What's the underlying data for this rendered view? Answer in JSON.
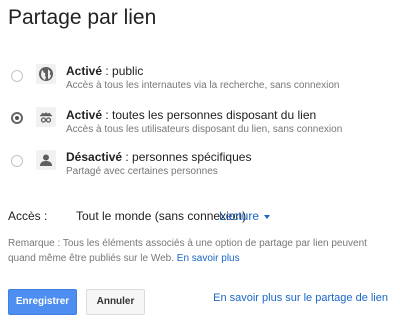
{
  "title": "Partage par lien",
  "options": [
    {
      "status": "Activé",
      "text": " : public",
      "description": "Accès à tous les internautes via la recherche, sans connexion",
      "icon": "globe-icon",
      "selected": false
    },
    {
      "status": "Activé",
      "text": " : toutes les personnes disposant du lien",
      "description": "Accès à tous les utilisateurs disposant du lien, sans connexion",
      "icon": "incognito-user-icon",
      "selected": true
    },
    {
      "status": "Désactivé",
      "text": " : personnes spécifiques",
      "description": "Partagé avec certaines personnes",
      "icon": "user-icon",
      "selected": false
    }
  ],
  "access": {
    "label": "Accès :",
    "value": "Tout le monde (sans connexion)",
    "permission": "Lecture"
  },
  "remark": {
    "text": "Remarque : Tous les éléments associés à une option de partage par lien peuvent quand même être publiés sur le Web. ",
    "link": "En savoir plus"
  },
  "buttons": {
    "save": "Enregistrer",
    "cancel": "Annuler"
  },
  "help_link": "En savoir plus sur le partage de lien",
  "colors": {
    "primary": "#4d8ef0",
    "link": "#1a66c8"
  }
}
